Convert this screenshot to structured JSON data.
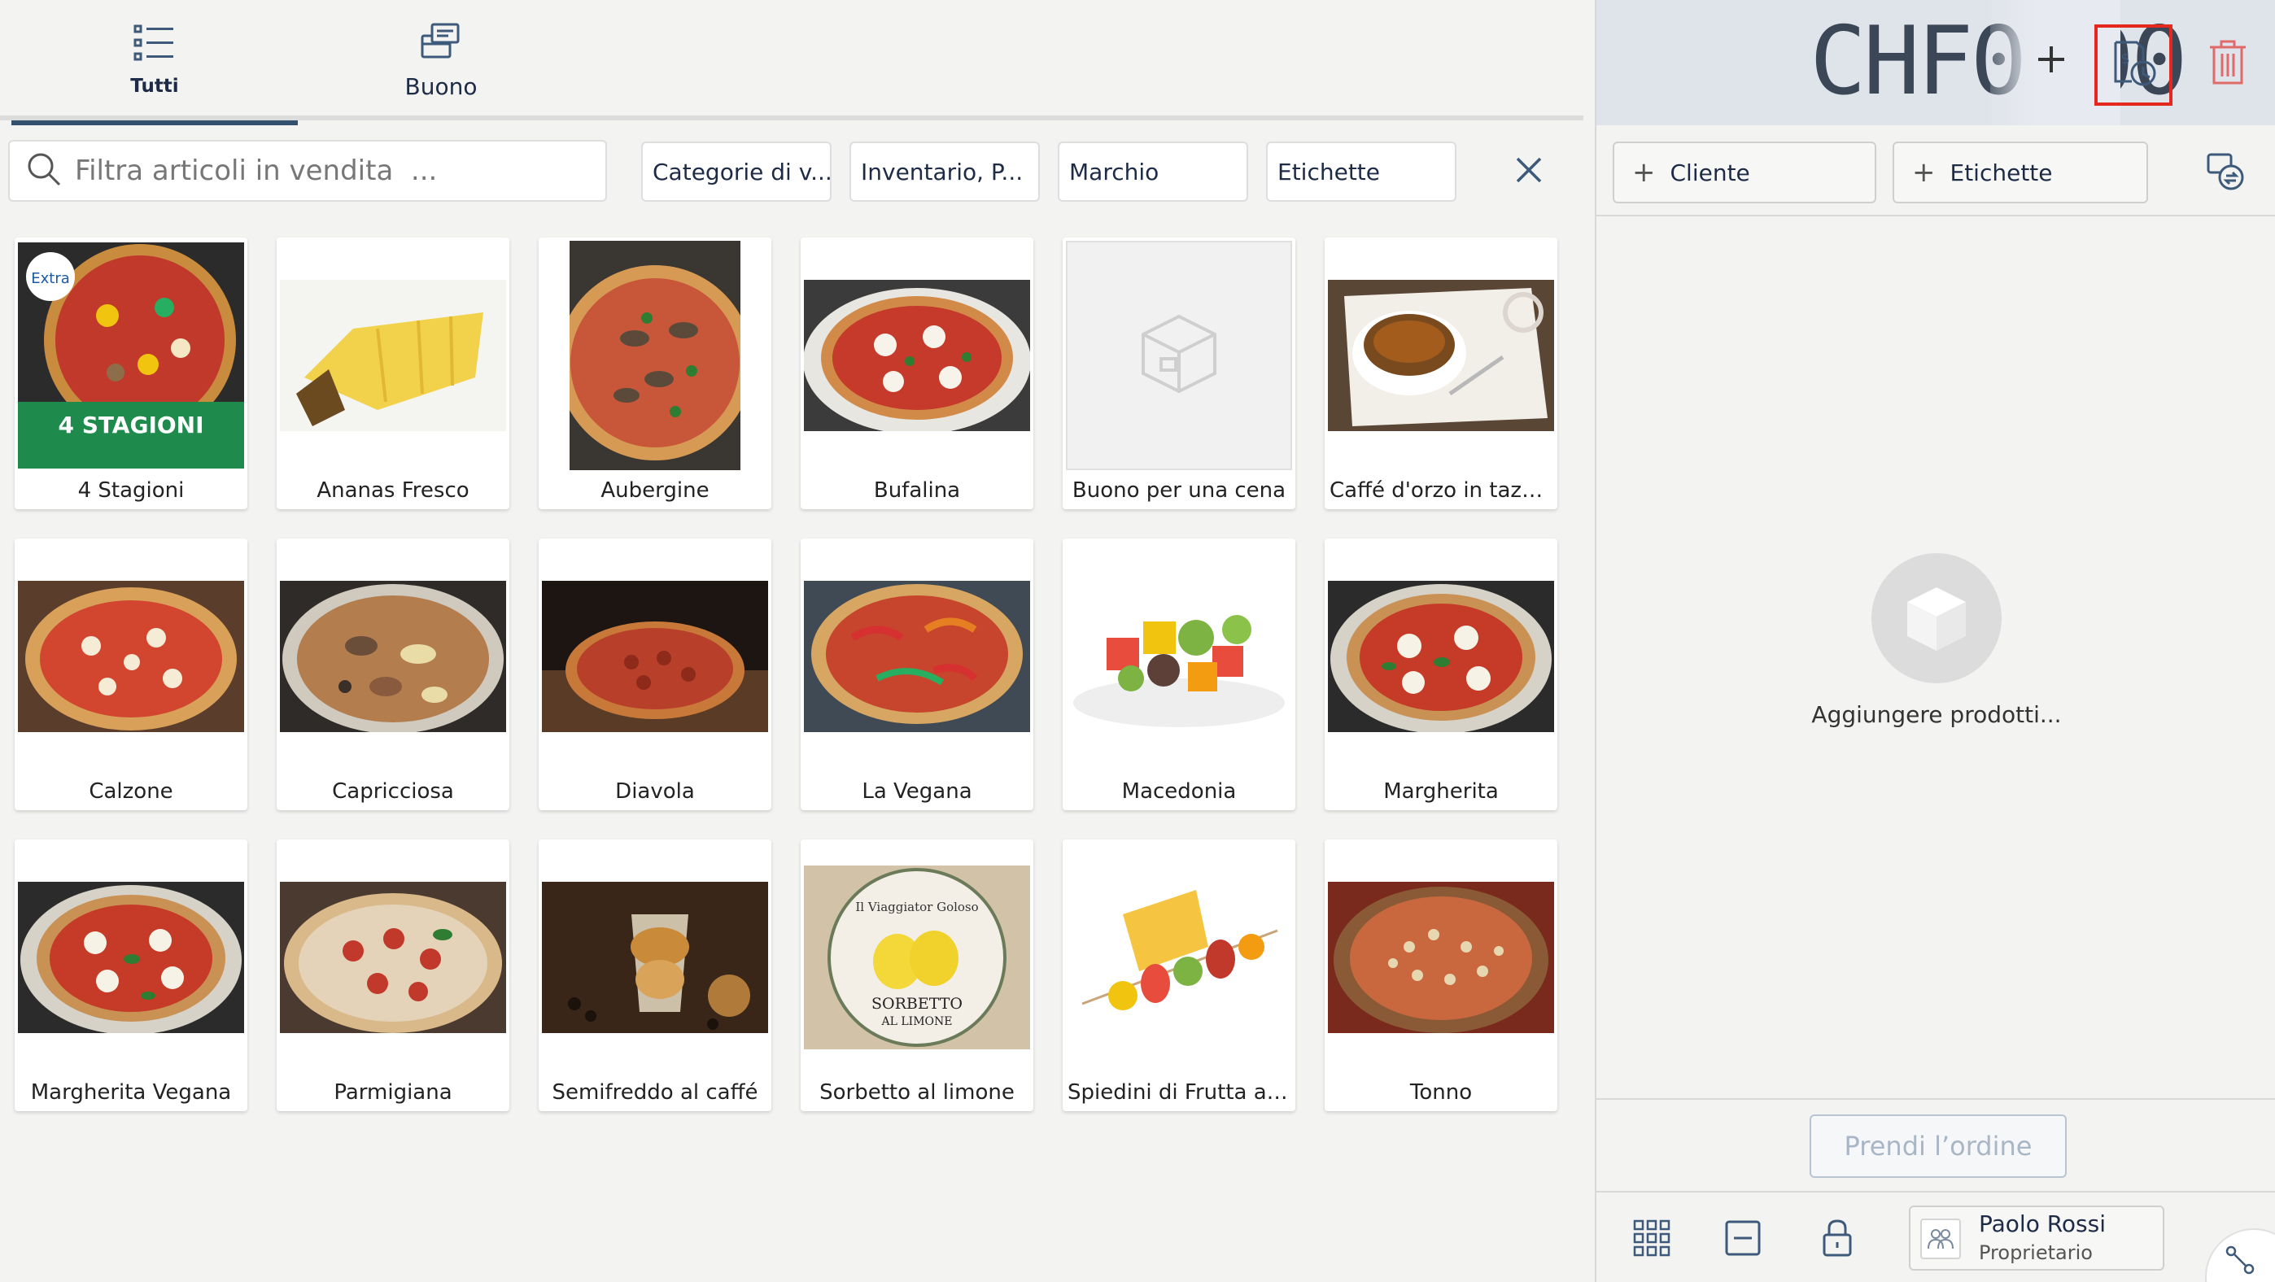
{
  "tabs": [
    {
      "label": "Tutti",
      "icon": "list-icon",
      "active": true
    },
    {
      "label": "Buono",
      "icon": "voucher-icon",
      "active": false
    }
  ],
  "search": {
    "placeholder": "Filtra articoli in vendita  ..."
  },
  "filters": [
    "Categorie di v...",
    "Inventario, P...",
    "Marchio",
    "Etichette"
  ],
  "products": [
    "4 Stagioni",
    "Ananas Fresco",
    "Aubergine",
    "Bufalina",
    "Buono per una cena",
    "Caffé d'orzo in tazz...",
    "Calzone",
    "Capricciosa",
    "Diavola",
    "La Vegana",
    "Macedonia",
    "Margherita",
    "Margherita Vegana",
    "Parmigiana",
    "Semifreddo al caffé",
    "Sorbetto al limone",
    "Spiedini di Frutta a ...",
    "Tonno"
  ],
  "cart": {
    "total": "CHF0,00",
    "customer_label": "Cliente",
    "tags_label": "Etichette",
    "empty_text": "Aggiungere prodotti...",
    "order_button": "Prendi l’ordine"
  },
  "user": {
    "name": "Paolo Rossi",
    "role": "Proprietario"
  },
  "colors": {
    "accent": "#34506f",
    "highlight": "#e5281f",
    "trash": "#e06a6a"
  }
}
